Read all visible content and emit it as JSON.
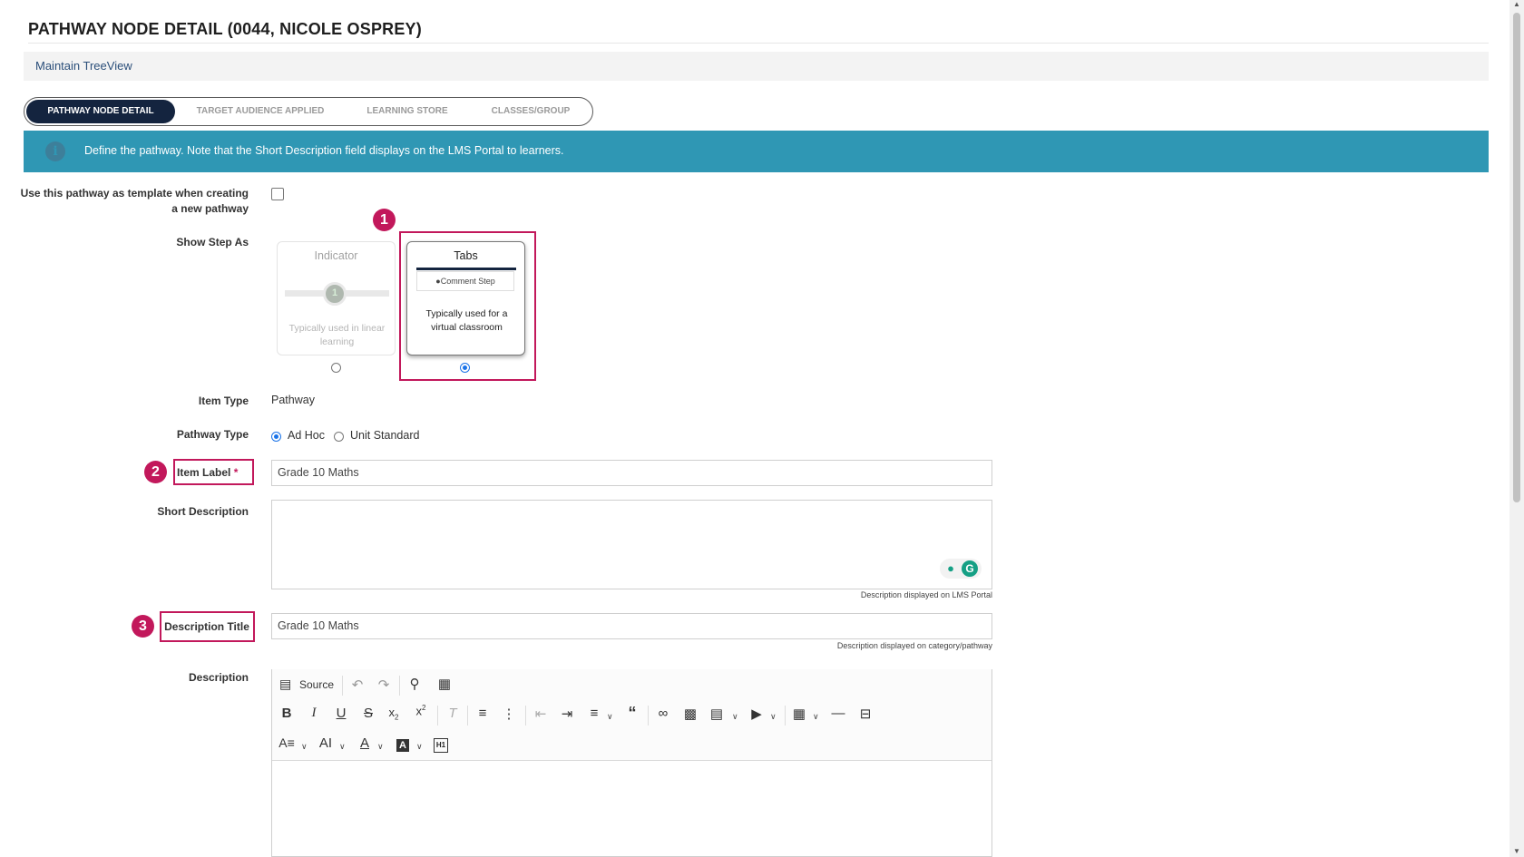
{
  "page": {
    "title": "PATHWAY NODE DETAIL (0044, NICOLE OSPREY)",
    "breadcrumb_link": "Maintain TreeView"
  },
  "tabs": [
    {
      "label": "PATHWAY NODE DETAIL",
      "active": true
    },
    {
      "label": "TARGET AUDIENCE APPLIED",
      "active": false
    },
    {
      "label": "LEARNING STORE",
      "active": false
    },
    {
      "label": "CLASSES/GROUP",
      "active": false
    }
  ],
  "info": {
    "text": "Define the pathway. Note that the Short Description field displays on the LMS Portal to learners.",
    "icon": "info-icon",
    "color": "#2f97b4"
  },
  "form": {
    "template_label": "Use this pathway as template when creating a new pathway",
    "template_checked": false,
    "show_step_label": "Show Step As",
    "indicator_card": {
      "title": "Indicator",
      "step_number": "1",
      "caption": "Typically used in linear learning",
      "selected": false
    },
    "tabs_card": {
      "title": "Tabs",
      "tab_text": "Comment Step",
      "caption": "Typically used for a virtual classroom",
      "selected": true
    },
    "item_type_label": "Item Type",
    "item_type_value": "Pathway",
    "pathway_type_label": "Pathway Type",
    "pathway_type_options": [
      {
        "label": "Ad Hoc",
        "checked": true
      },
      {
        "label": "Unit Standard",
        "checked": false
      }
    ],
    "item_label_label": "Item Label",
    "required_mark": "*",
    "item_label_value": "Grade 10 Maths",
    "short_desc_label": "Short Description",
    "short_desc_value": "",
    "short_desc_hint": "Description displayed on LMS Portal",
    "desc_title_label": "Description Title",
    "desc_title_value": "Grade 10 Maths",
    "desc_title_hint": "Description displayed on category/pathway",
    "description_label": "Description"
  },
  "editor": {
    "source_label": "Source"
  },
  "annotations": {
    "badge1": "1",
    "badge2": "2",
    "badge3": "3",
    "color": "#c2185b"
  }
}
